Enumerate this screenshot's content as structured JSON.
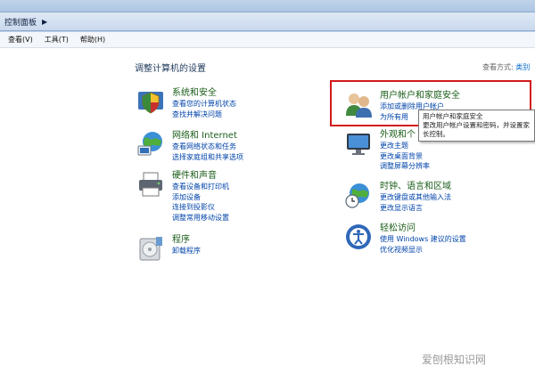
{
  "breadcrumb": {
    "label": "控制面板"
  },
  "menu": [
    "查看(V)",
    "工具(T)",
    "帮助(H)"
  ],
  "main_title": "调整计算机的设置",
  "view_by": {
    "label": "查看方式:",
    "value": "类别"
  },
  "categories_left": [
    {
      "title": "系统和安全",
      "links": [
        "查看您的计算机状态",
        "查找并解决问题"
      ]
    },
    {
      "title": "网络和 Internet",
      "links": [
        "查看网络状态和任务",
        "选择家庭组和共享选项"
      ]
    },
    {
      "title": "硬件和声音",
      "links": [
        "查看设备和打印机",
        "添加设备",
        "连接到投影仪",
        "调整常用移动设置"
      ]
    },
    {
      "title": "程序",
      "links": [
        "卸载程序"
      ]
    }
  ],
  "categories_right": [
    {
      "title": "用户帐户和家庭安全",
      "links": [
        "添加或删除用户帐户",
        "为所有用"
      ]
    },
    {
      "title": "外观和个",
      "links": [
        "更改主题",
        "更改桌面背景",
        "调整屏幕分辨率"
      ]
    },
    {
      "title": "时钟、语言和区域",
      "links": [
        "更改键盘或其他输入法",
        "更改显示语言"
      ]
    },
    {
      "title": "轻松访问",
      "links": [
        "使用 Windows 建议的设置",
        "优化视频显示"
      ]
    }
  ],
  "tooltip": [
    "用户帐户和家庭安全",
    "更改用户帐户设置和密码，并设置家",
    "长控制。"
  ],
  "watermark": "爱刨根知识网"
}
